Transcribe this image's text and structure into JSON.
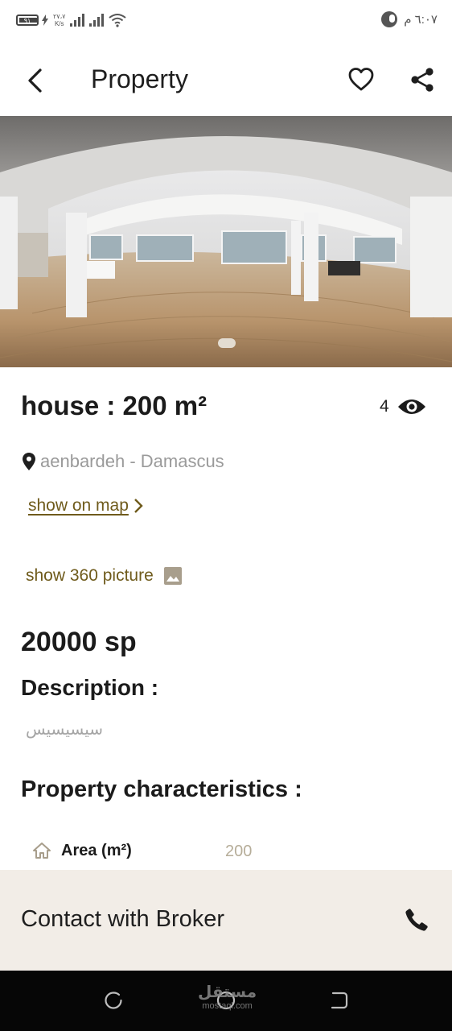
{
  "status_bar": {
    "battery": "٩١",
    "net_speed_value": "٢٧،٧",
    "net_speed_unit": "K/s",
    "time": "٦:٠٧ م"
  },
  "header": {
    "title": "Property",
    "icons": [
      "back-arrow-icon",
      "heart-icon",
      "share-icon"
    ]
  },
  "hero": {
    "image": "360 panorama of empty room with wooden floor and windows"
  },
  "property": {
    "name": "house : 200 m²",
    "views": "4",
    "location": "aenbardeh - Damascus",
    "show_on_map": "show on map",
    "show_360": "show 360 picture",
    "price": "20000 sp"
  },
  "description": {
    "heading": "Description :",
    "text": "سيسيسيس"
  },
  "characteristics": {
    "heading": "Property characteristics :",
    "rows": [
      {
        "label": "Area (m²)",
        "value": "200"
      }
    ]
  },
  "contact": {
    "label": "Contact with Broker"
  },
  "watermark": {
    "arabic": "مستقل",
    "latin": "mostaql.com"
  },
  "colors": {
    "accent": "#6f5b1c",
    "contact_bg": "#f2ede7",
    "muted": "#9a9a9a",
    "nav_bg": "#060606"
  }
}
